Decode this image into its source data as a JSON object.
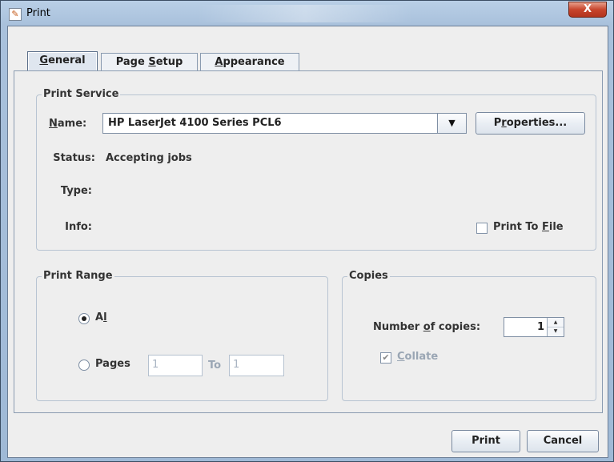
{
  "window": {
    "title": "Print",
    "close_glyph": "X",
    "app_icon_glyph": "✎"
  },
  "tabs": [
    {
      "label_pre": "",
      "mnemonic": "G",
      "label_post": "eneral",
      "active": true
    },
    {
      "label_pre": "Page ",
      "mnemonic": "S",
      "label_post": "etup",
      "active": false
    },
    {
      "label_pre": "",
      "mnemonic": "A",
      "label_post": "ppearance",
      "active": false
    }
  ],
  "print_service": {
    "group_title": "Print Service",
    "name_label_mnemonic": "N",
    "name_label_rest": "ame:",
    "printer_name": "HP LaserJet 4100 Series PCL6",
    "properties_pre": "P",
    "properties_mnemonic": "r",
    "properties_post": "operties...",
    "status_label": "Status:",
    "status_value": "Accepting jobs",
    "type_label": "Type:",
    "type_value": "",
    "info_label": "Info:",
    "info_value": "",
    "print_to_file_pre": "Print To ",
    "print_to_file_mnemonic": "F",
    "print_to_file_post": "ile",
    "print_to_file_checked": false
  },
  "print_range": {
    "group_title": "Print Range",
    "all_pre": "A",
    "all_mnemonic": "l",
    "all_post": "l",
    "all_selected": true,
    "pages_pre": "Pa",
    "pages_mnemonic": "g",
    "pages_post": "es",
    "pages_from": "1",
    "to_label": "To",
    "pages_to": "1"
  },
  "copies": {
    "group_title": "Copies",
    "number_pre": "Number ",
    "number_mnemonic": "o",
    "number_post": "f copies:",
    "number_value": "1",
    "collate_mnemonic": "C",
    "collate_post": "ollate",
    "collate_checked": true,
    "collate_check_glyph": "✔"
  },
  "buttons": {
    "print": "Print",
    "cancel": "Cancel"
  },
  "colors": {
    "close_button": "#c7452c",
    "title_bar": "#a9c1dc",
    "dialog_bg": "#eeeeee"
  }
}
